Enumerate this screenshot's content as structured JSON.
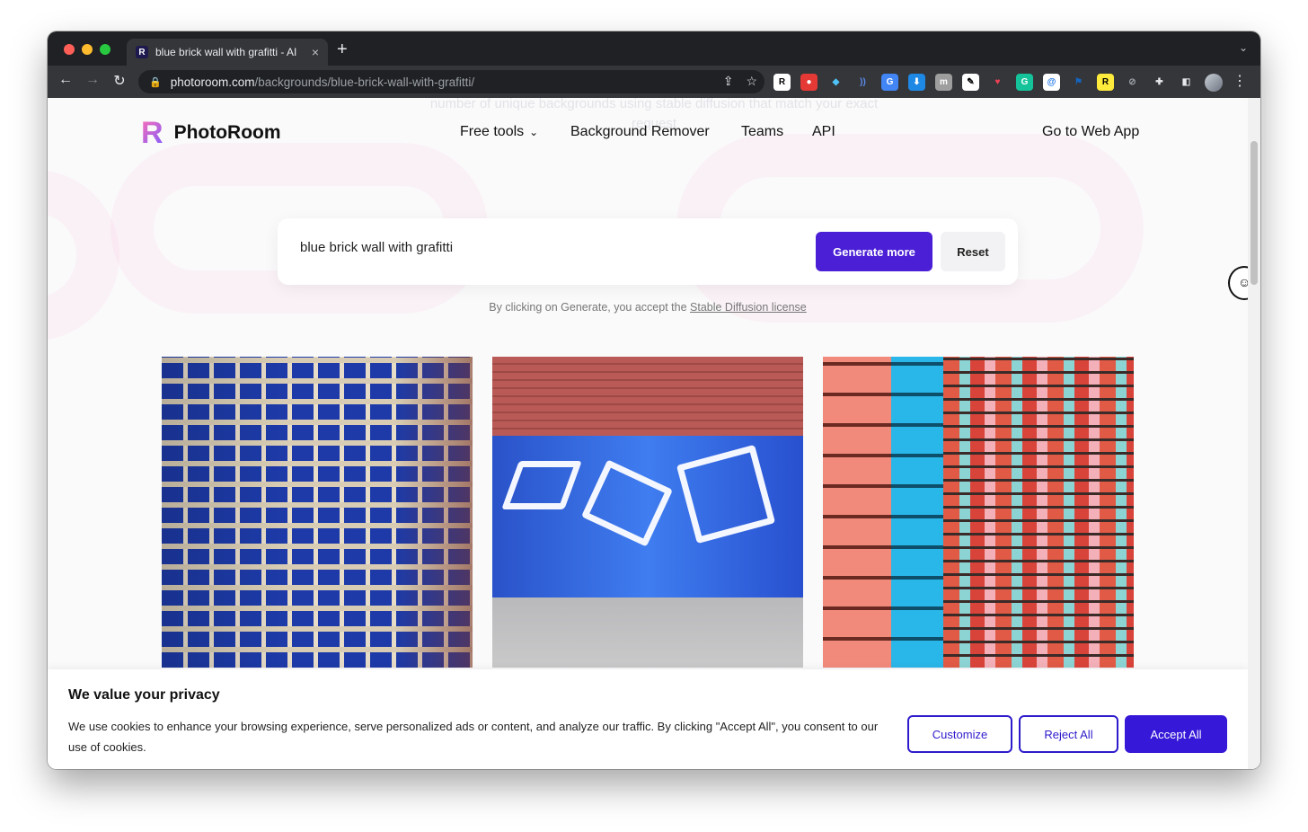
{
  "browser": {
    "tab_title": "blue brick wall with grafitti - AI",
    "tab_favicon": "R",
    "tab_close": "×",
    "new_tab": "+",
    "url_host": "photoroom.com",
    "url_path": "/backgrounds/blue-brick-wall-with-grafitti/",
    "extensions": [
      {
        "name": "reader-ext-icon",
        "label": "R",
        "color": "#ffffff",
        "fg": "#000000"
      },
      {
        "name": "pokeball-ext-icon",
        "label": "●",
        "color": "#e53935",
        "fg": "#ffffff"
      },
      {
        "name": "diamond-ext-icon",
        "label": "◆",
        "color": "#35363a",
        "fg": "#4fc3f7"
      },
      {
        "name": "wave-ext-icon",
        "label": "))",
        "color": "#35363a",
        "fg": "#5a8dee"
      },
      {
        "name": "translate-ext-icon",
        "label": "G",
        "color": "#4285f4",
        "fg": "#ffffff"
      },
      {
        "name": "download-ext-icon",
        "label": "⬇",
        "color": "#1e88e5",
        "fg": "#ffffff"
      },
      {
        "name": "m-ext-icon",
        "label": "m",
        "color": "#9e9e9e",
        "fg": "#ffffff"
      },
      {
        "name": "edit-ext-icon",
        "label": "✎",
        "color": "#ffffff",
        "fg": "#000000"
      },
      {
        "name": "pocket-ext-icon",
        "label": "♥",
        "color": "#35363a",
        "fg": "#ef4056"
      },
      {
        "name": "grammarly-ext-icon",
        "label": "G",
        "color": "#15c39a",
        "fg": "#ffffff"
      },
      {
        "name": "at-ext-icon",
        "label": "@",
        "color": "#ffffff",
        "fg": "#1a73e8"
      },
      {
        "name": "flag-ext-icon",
        "label": "⚑",
        "color": "#35363a",
        "fg": "#1565c0"
      },
      {
        "name": "r-yellow-ext-icon",
        "label": "R",
        "color": "#ffeb3b",
        "fg": "#000000"
      },
      {
        "name": "blocked-ext-icon",
        "label": "⊘",
        "color": "#35363a",
        "fg": "#9aa0a6"
      },
      {
        "name": "puzzle-ext-icon",
        "label": "✚",
        "color": "#35363a",
        "fg": "#e8eaed"
      },
      {
        "name": "sidepanel-ext-icon",
        "label": "◧",
        "color": "#35363a",
        "fg": "#e8eaed"
      }
    ]
  },
  "header": {
    "logo_text": "PhotoRoom",
    "nav_free_tools": "Free tools",
    "nav_background_remover": "Background Remover",
    "nav_teams": "Teams",
    "nav_api": "API",
    "nav_web_app": "Go to Web App"
  },
  "ghost_text": "number of unique backgrounds using stable diffusion that match your exact request",
  "search": {
    "value": "blue brick wall with grafitti",
    "generate_label": "Generate more",
    "reset_label": "Reset",
    "license_prefix": "By clicking on Generate, you accept the ",
    "license_link": "Stable Diffusion license"
  },
  "cookie": {
    "title": "We value your privacy",
    "text": "We use cookies to enhance your browsing experience, serve personalized ads or content, and analyze our traffic. By clicking \"Accept All\", you consent to our use of cookies.",
    "customize_label": "Customize",
    "reject_label": "Reject All",
    "accept_label": "Accept All"
  },
  "colors": {
    "accent": "#4a1fd6",
    "cookie_accent": "#3618d8"
  }
}
